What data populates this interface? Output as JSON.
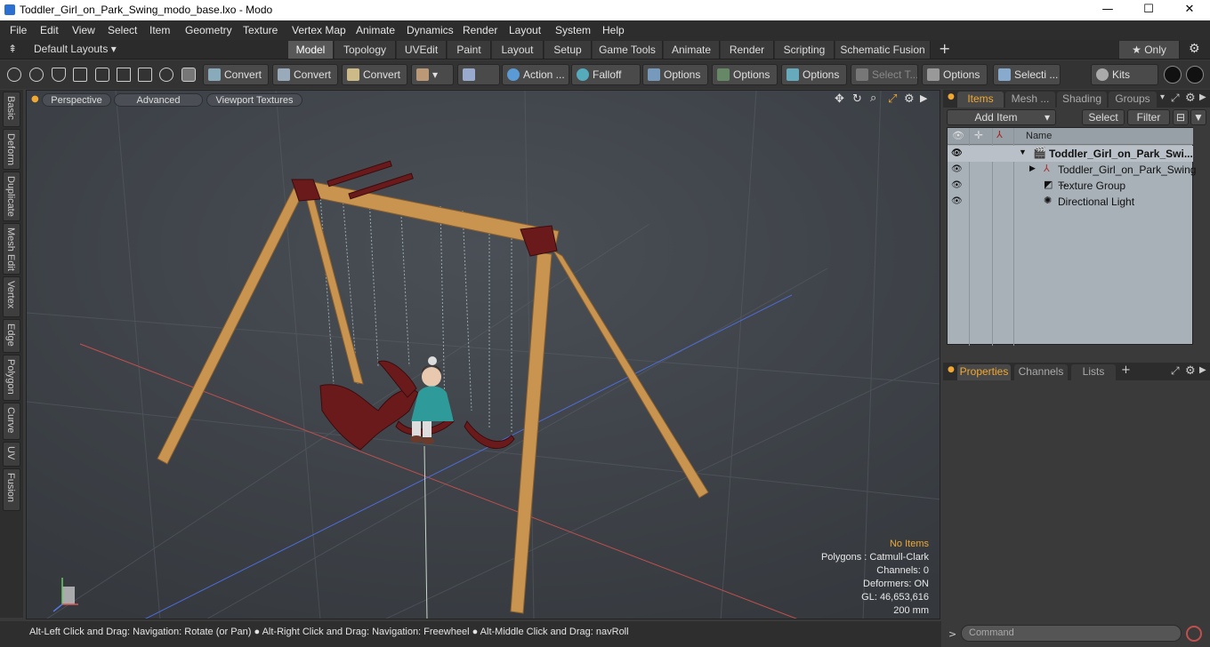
{
  "window": {
    "title": "Toddler_Girl_on_Park_Swing_modo_base.lxo - Modo",
    "minimize": "—",
    "maximize": "☐",
    "close": "✕"
  },
  "menu": [
    "File",
    "Edit",
    "View",
    "Select",
    "Item",
    "Geometry",
    "Texture",
    "Vertex Map",
    "Animate",
    "Dynamics",
    "Render",
    "Layout",
    "System",
    "Help"
  ],
  "layout": {
    "selector": "Default Layouts ▾",
    "tabs": [
      "Model",
      "Topology",
      "UVEdit",
      "Paint",
      "Layout",
      "Setup",
      "Game Tools",
      "Animate",
      "Render",
      "Scripting",
      "Schematic Fusion"
    ],
    "active_tab": "Model",
    "only_label": "★ Only"
  },
  "toolbar": {
    "convert1": "Convert",
    "convert2": "Convert",
    "convert3": "Convert",
    "action": "Action ...",
    "falloff": "Falloff",
    "options1": "Options",
    "options2": "Options",
    "options3": "Options",
    "options4": "Options",
    "select_t": "Select T...",
    "selecti": "Selecti ...",
    "kits": "Kits"
  },
  "left_tabs": [
    "Basic",
    "Deform",
    "Duplicate",
    "Mesh Edit",
    "Vertex",
    "Edge",
    "Polygon",
    "Curve",
    "UV",
    "Fusion"
  ],
  "viewport": {
    "perspective": "Perspective",
    "advanced": "Advanced",
    "textures": "Viewport Textures",
    "info": {
      "no_items": "No Items",
      "polygons": "Polygons : Catmull-Clark",
      "channels": "Channels: 0",
      "deformers": "Deformers: ON",
      "gl": "GL: 46,653,616",
      "scale": "200 mm"
    }
  },
  "status": {
    "text": "Alt-Left Click and Drag: Navigation: Rotate (or Pan) ● Alt-Right Click and Drag: Navigation: Freewheel ● Alt-Middle Click and Drag: navRoll"
  },
  "items_panel": {
    "tabs": [
      "Items",
      "Mesh ...",
      "Shading",
      "Groups"
    ],
    "add_item": "Add Item",
    "select": "Select",
    "filter": "Filter",
    "name_header": "Name",
    "rows": [
      {
        "label": "Toddler_Girl_on_Park_Swi..."
      },
      {
        "label": "Toddler_Girl_on_Park_Swing ..."
      },
      {
        "label": "Texture Group"
      },
      {
        "label": "Directional Light"
      }
    ]
  },
  "properties_panel": {
    "tabs": [
      "Properties",
      "Channels",
      "Lists"
    ],
    "add": "+"
  },
  "command": {
    "placeholder": "Command"
  },
  "colors": {
    "accent": "#f0a832",
    "wood": "#c8944f",
    "metal_red": "#6b1a1c",
    "dress": "#2f9a9a"
  }
}
